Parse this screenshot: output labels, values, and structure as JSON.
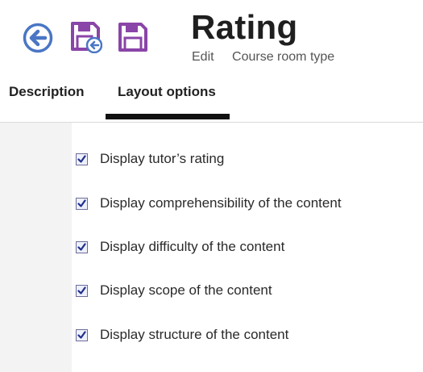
{
  "header": {
    "title": "Rating",
    "breadcrumb": [
      "Edit",
      "Course room type"
    ]
  },
  "toolbar": {
    "back_icon": "arrow-left-circle-icon",
    "save_close_icon": "save-and-close-icon",
    "save_icon": "floppy-disk-icon",
    "colors": {
      "back": "#4a76c4",
      "save": "#8a45a8"
    }
  },
  "tabs": [
    {
      "label": "Description",
      "active": false
    },
    {
      "label": "Layout options",
      "active": true
    }
  ],
  "options": [
    {
      "label": "Display tutor’s rating",
      "checked": true
    },
    {
      "label": "Display comprehensibility of the content",
      "checked": true
    },
    {
      "label": "Display difficulty of the content",
      "checked": true
    },
    {
      "label": "Display scope of the content",
      "checked": true
    },
    {
      "label": "Display structure of the content",
      "checked": true
    }
  ]
}
